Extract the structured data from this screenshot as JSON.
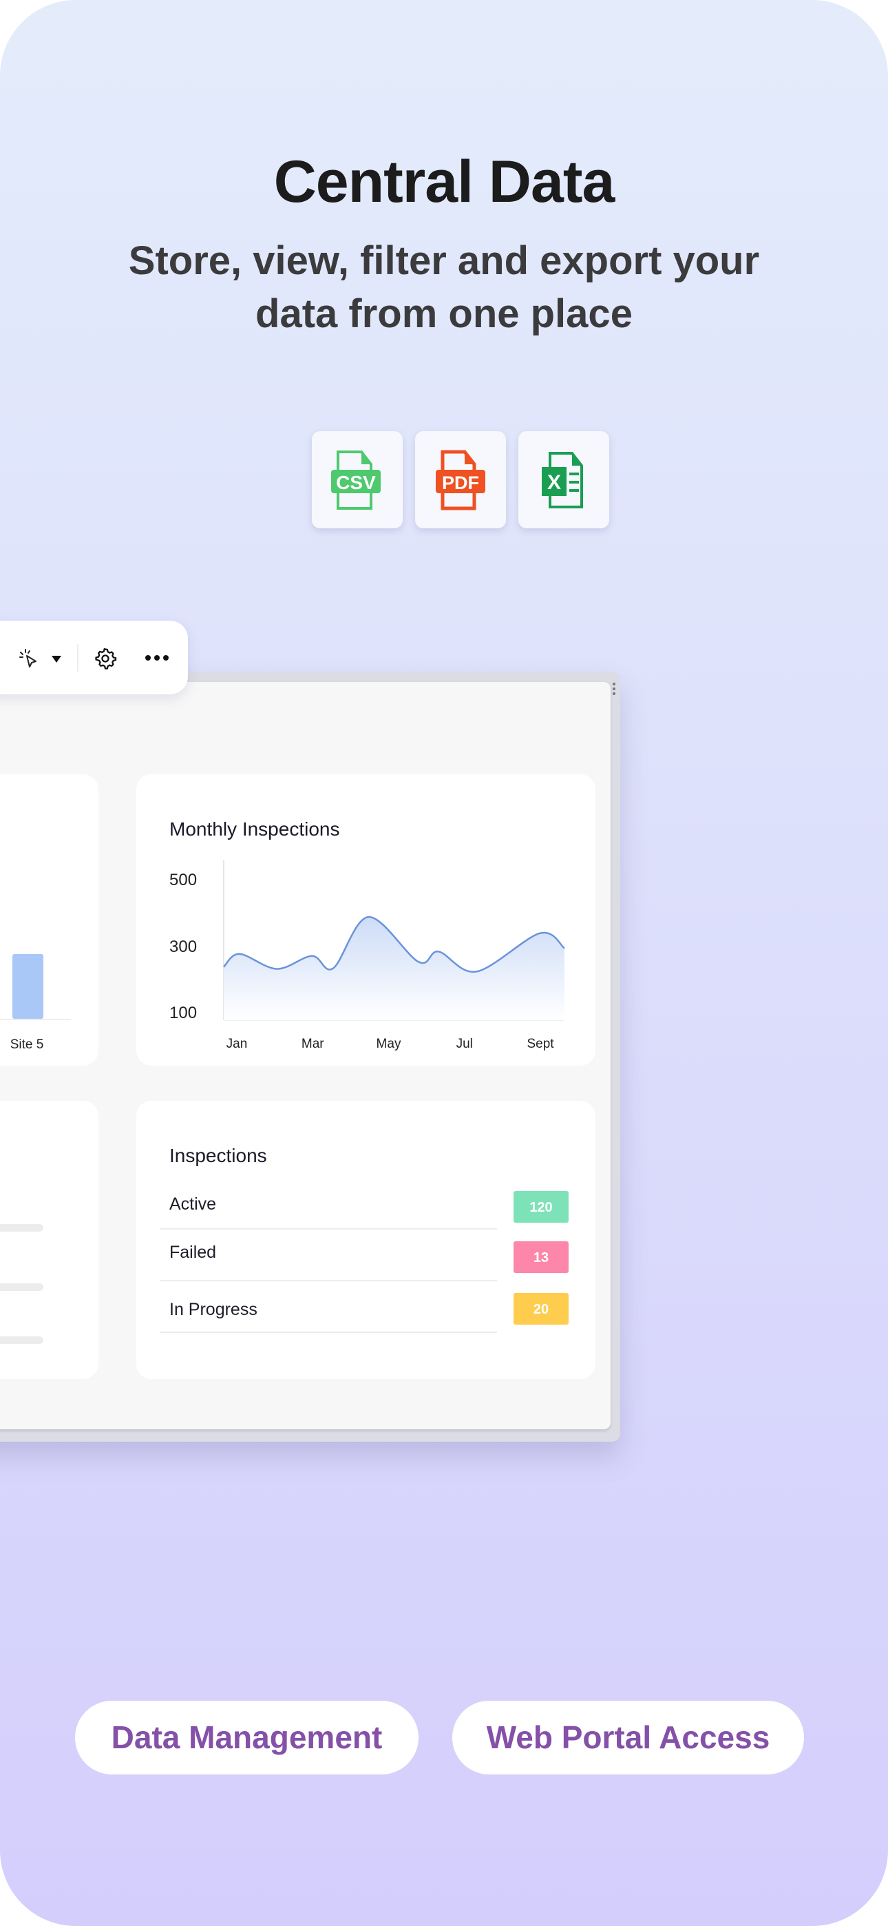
{
  "header": {
    "title": "Central Data",
    "subtitle_line1": "Store, view, filter and export your",
    "subtitle_line2": "data from one place"
  },
  "export_formats": [
    {
      "label": "CSV",
      "icon": "csv-file-icon",
      "color": "#4fc96e"
    },
    {
      "label": "PDF",
      "icon": "pdf-file-icon",
      "color": "#ef5122"
    },
    {
      "label": "X",
      "icon": "excel-file-icon",
      "color": "#1a9e52"
    }
  ],
  "toolbar": {
    "icons": [
      "cursor-click-icon",
      "dropdown-caret-icon",
      "gear-icon",
      "more-horizontal-icon"
    ]
  },
  "site_chart": {
    "label": "Site 5",
    "bar_color": "#a9c8f7"
  },
  "chart_data": {
    "type": "area",
    "title": "Monthly Inspections",
    "xlabel": "",
    "ylabel": "",
    "x_tick_labels": [
      "Jan",
      "Mar",
      "May",
      "Jul",
      "Sept"
    ],
    "x_tick_months": [
      1,
      3,
      5,
      7,
      9
    ],
    "ylim": [
      80,
      560
    ],
    "y_ticks": [
      500,
      300,
      100
    ],
    "xlim": [
      0.65,
      9.64
    ],
    "x": [
      0.65,
      1.07,
      2.05,
      2.98,
      3.54,
      4.47,
      5.79,
      6.32,
      7.32,
      8.99,
      9.64
    ],
    "y": [
      240,
      279,
      234,
      273,
      236,
      390,
      255,
      286,
      226,
      341,
      296
    ],
    "line_color": "#6b93dc",
    "fill_color": "#cddcf7",
    "grid": false,
    "legend": "none"
  },
  "inspections": {
    "title": "Inspections",
    "rows": [
      {
        "label": "Active",
        "count": "120",
        "color": "#7ee2b8"
      },
      {
        "label": "Failed",
        "count": "13",
        "color": "#fc87ab"
      },
      {
        "label": "In Progress",
        "count": "20",
        "color": "#fecd4d"
      }
    ]
  },
  "tags": [
    {
      "label": "Data Management"
    },
    {
      "label": "Web Portal Access"
    }
  ]
}
